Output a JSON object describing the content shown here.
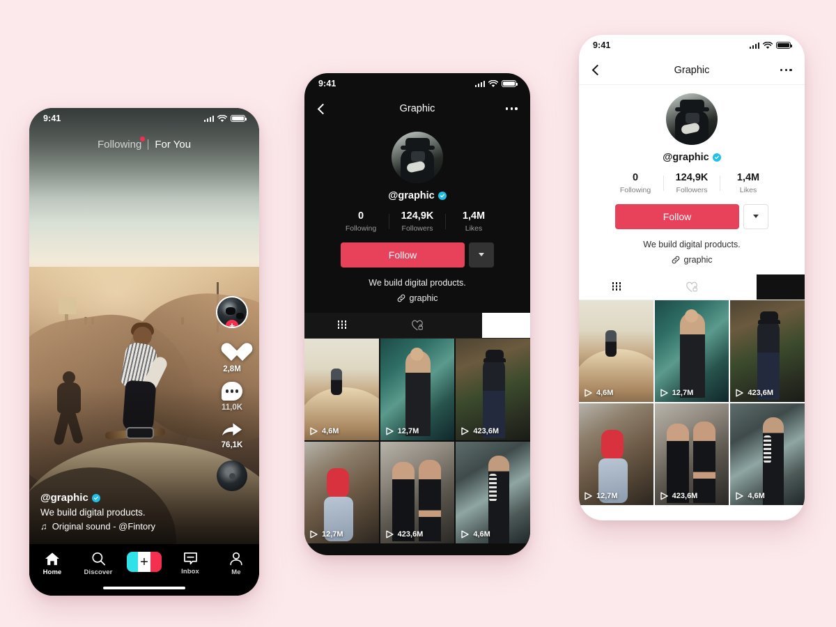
{
  "background_color": "#fce9ec",
  "accent_color": "#e8415a",
  "verified_color": "#1fc0e8",
  "feed_screen": {
    "status_bar": {
      "time": "9:41"
    },
    "tabs": [
      {
        "label": "Following",
        "active": false,
        "has_badge": true
      },
      {
        "label": "For You",
        "active": true,
        "has_badge": false
      }
    ],
    "actions": [
      {
        "icon": "avatar-plus-icon",
        "count": ""
      },
      {
        "icon": "heart-icon",
        "count": "2,8M"
      },
      {
        "icon": "comment-icon",
        "count": "11,0K"
      },
      {
        "icon": "share-icon",
        "count": "76,1K"
      }
    ],
    "caption": {
      "username": "@graphic",
      "verified": true,
      "bio": "We build digital products.",
      "sound": "Original sound - @Fintory",
      "music_note": "♫"
    },
    "tabbar": [
      {
        "label": "Home",
        "icon": "home-icon",
        "active": true
      },
      {
        "label": "Discover",
        "icon": "search-icon",
        "active": false
      },
      {
        "label": "",
        "icon": "create-plus-icon",
        "active": false
      },
      {
        "label": "Inbox",
        "icon": "inbox-icon",
        "active": false
      },
      {
        "label": "Me",
        "icon": "person-icon",
        "active": false
      }
    ]
  },
  "profile_dark": {
    "theme": "dark",
    "status_bar": {
      "time": "9:41"
    },
    "header": {
      "title": "Graphic",
      "back_icon": "chevron-left-icon",
      "menu_icon": "more-dots-icon"
    },
    "handle": "@graphic",
    "verified": true,
    "stats": [
      {
        "value": "0",
        "label": "Following"
      },
      {
        "value": "124,9K",
        "label": "Followers"
      },
      {
        "value": "1,4M",
        "label": "Likes"
      }
    ],
    "follow_button": "Follow",
    "caret_icon": "chevron-down-icon",
    "bio": "We build digital products.",
    "link": "graphic",
    "link_icon": "link-icon",
    "segments": [
      {
        "icon": "grid-bars-icon",
        "active": true
      },
      {
        "icon": "liked-heart-lock-icon",
        "active": false
      }
    ],
    "videos": [
      {
        "views": "4,6M",
        "thumb": "th1"
      },
      {
        "views": "12,7M",
        "thumb": "th2"
      },
      {
        "views": "423,6M",
        "thumb": "th3"
      },
      {
        "views": "12,7M",
        "thumb": "th4"
      },
      {
        "views": "423,6M",
        "thumb": "th5"
      },
      {
        "views": "4,6M",
        "thumb": "th6"
      }
    ]
  },
  "profile_light": {
    "theme": "light",
    "status_bar": {
      "time": "9:41"
    },
    "header": {
      "title": "Graphic",
      "back_icon": "chevron-left-icon",
      "menu_icon": "more-dots-icon"
    },
    "handle": "@graphic",
    "verified": true,
    "stats": [
      {
        "value": "0",
        "label": "Following"
      },
      {
        "value": "124,9K",
        "label": "Followers"
      },
      {
        "value": "1,4M",
        "label": "Likes"
      }
    ],
    "follow_button": "Follow",
    "caret_icon": "chevron-down-icon",
    "bio": "We build digital products.",
    "link": "graphic",
    "link_icon": "link-icon",
    "segments": [
      {
        "icon": "grid-bars-icon",
        "active": true
      },
      {
        "icon": "liked-heart-lock-icon",
        "active": false
      }
    ],
    "videos": [
      {
        "views": "4,6M",
        "thumb": "th1"
      },
      {
        "views": "12,7M",
        "thumb": "th2"
      },
      {
        "views": "423,6M",
        "thumb": "th3"
      },
      {
        "views": "12,7M",
        "thumb": "th4"
      },
      {
        "views": "423,6M",
        "thumb": "th5"
      },
      {
        "views": "4,6M",
        "thumb": "th6"
      }
    ]
  }
}
